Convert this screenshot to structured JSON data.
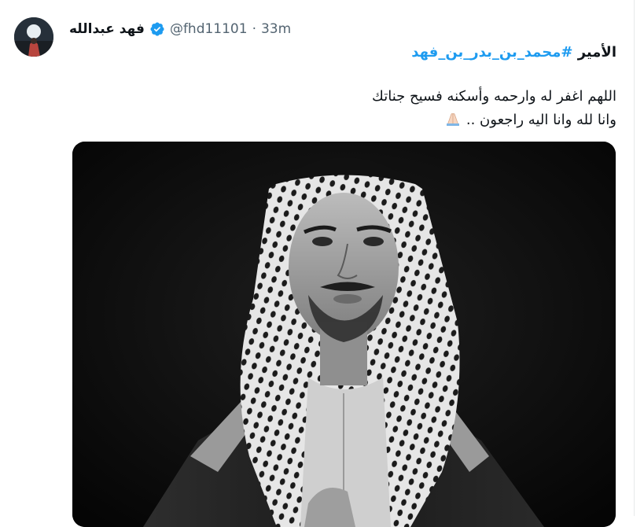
{
  "author": {
    "display_name": "فهد عبدالله",
    "handle": "@fhd11101",
    "separator": "·",
    "time": "33m",
    "verified": true,
    "avatar_icon": "avatar-image"
  },
  "tweet": {
    "line1_prefix": "الأمير",
    "hashtag": "#محمد_بن_بدر_بن_فهد",
    "line2": "اللهم اغفر له وارحمه وأسكنه فسيح جناتك",
    "line3": "وانا لله وانا اليه راجعون ..",
    "line3_emoji": "folded-hands-icon"
  },
  "media": {
    "type": "photo",
    "description_icon": "portrait-photo"
  },
  "colors": {
    "accent": "#1d9bf0",
    "text": "#0f1419",
    "secondary": "#536471",
    "border": "#e7e9ea"
  }
}
